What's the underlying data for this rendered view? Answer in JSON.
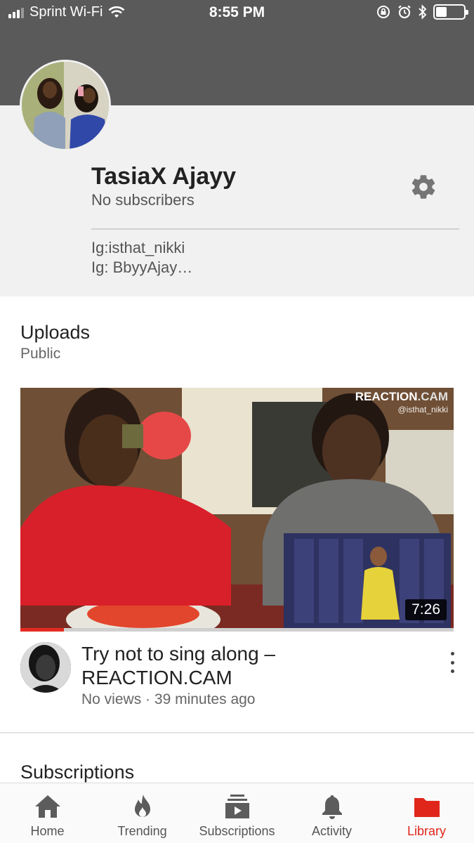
{
  "status_bar": {
    "carrier": "Sprint Wi-Fi",
    "time": "8:55 PM",
    "battery_level": 0.4
  },
  "channel": {
    "name": "TasiaX Ajayy",
    "subscribers": "No subscribers",
    "about_lines": [
      "Ig:isthat_nikki",
      "Ig: BbyyAjay…"
    ]
  },
  "uploads": {
    "title": "Uploads",
    "visibility": "Public",
    "videos": [
      {
        "title": "Try not to sing along – REACTION.CAM",
        "views": "No views",
        "separator": "·",
        "age": "39 minutes ago",
        "duration": "7:26",
        "watch_progress": 0.1,
        "watermark": {
          "brand": "REACTION",
          "suffix": ".CAM",
          "handle": "@isthat_nikki"
        }
      }
    ]
  },
  "subscriptions": {
    "title": "Subscriptions"
  },
  "bottom_nav": {
    "items": [
      {
        "label": "Home",
        "icon": "home-icon"
      },
      {
        "label": "Trending",
        "icon": "flame-icon"
      },
      {
        "label": "Subscriptions",
        "icon": "subscriptions-icon"
      },
      {
        "label": "Activity",
        "icon": "bell-icon"
      },
      {
        "label": "Library",
        "icon": "folder-icon",
        "active": true
      }
    ]
  },
  "colors": {
    "accent": "#e0261b",
    "banner": "#5a5a5a",
    "header_bg": "#f1f1f1"
  }
}
